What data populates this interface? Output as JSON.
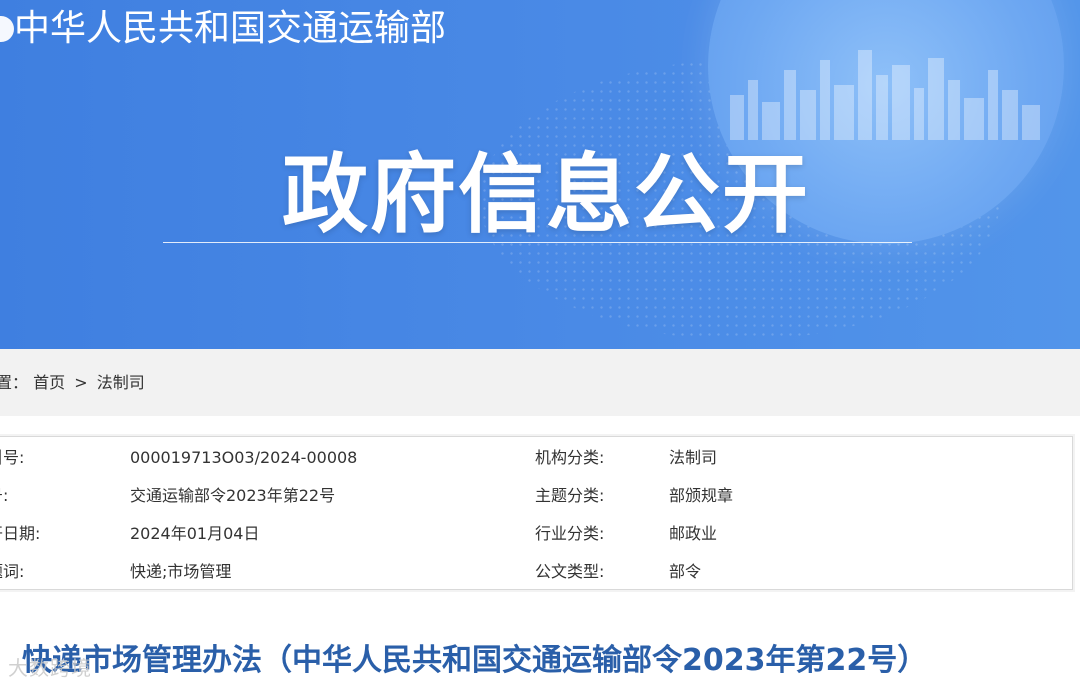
{
  "header": {
    "org_name": "中华人民共和国交通运输部",
    "banner_title": "政府信息公开"
  },
  "breadcrumb": {
    "prefix": "置：",
    "items": [
      "首页",
      "法制司"
    ],
    "separator": ">"
  },
  "info": {
    "rows": [
      {
        "label1": "索引号:",
        "value1": "000019713O03/2024-00008",
        "label2": "机构分类:",
        "value2": "法制司"
      },
      {
        "label1": "文号:",
        "value1": "交通运输部令2023年第22号",
        "label2": "主题分类:",
        "value2": "部颁规章"
      },
      {
        "label1": "公开日期:",
        "value1": "2024年01月04日",
        "label2": "行业分类:",
        "value2": "邮政业"
      },
      {
        "label1": "主题词:",
        "value1": "快递;市场管理",
        "label2": "公文类型:",
        "value2": "部令"
      }
    ]
  },
  "article": {
    "title": "快递市场管理办法（中华人民共和国交通运输部令2023年第22号）"
  },
  "watermark": "大数跨境",
  "colors": {
    "banner_blue": "#4a8ae6",
    "title_blue": "#2a5fa9",
    "breadcrumb_bg": "#f2f2f2"
  }
}
